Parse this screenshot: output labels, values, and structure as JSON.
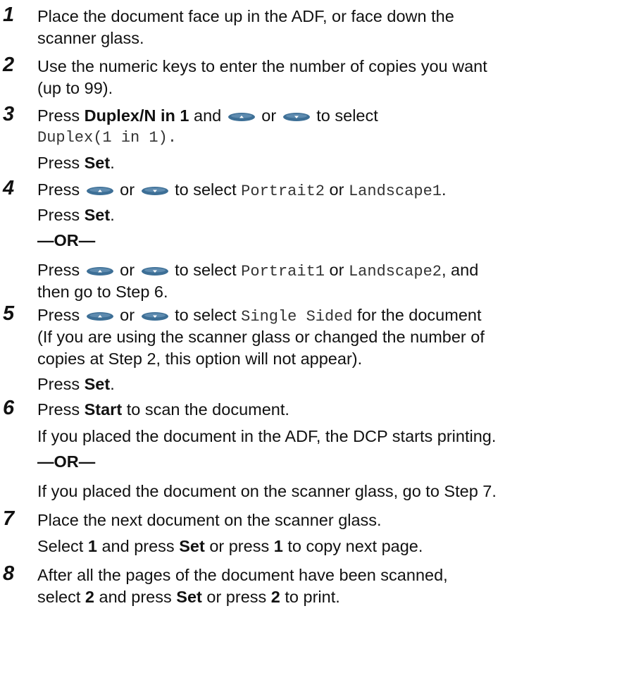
{
  "steps": [
    {
      "num": "1",
      "lines": [
        "Place the document face up in the ADF, or face down the",
        "scanner glass."
      ]
    },
    {
      "num": "2",
      "lines": [
        "Use the numeric keys to enter the number of copies you want",
        "(up to 99)."
      ]
    },
    {
      "num": "3",
      "press": "Press",
      "btn_duplex": "Duplex/N in 1",
      "and": "and",
      "or": "or",
      "to_select": "to select",
      "mode": "Duplex(1 in 1).",
      "press_set_a": "Press",
      "set": "Set",
      "period": "."
    },
    {
      "num": "4",
      "press": "Press",
      "or": "or",
      "to_select": "to select",
      "opt_a": "Portrait2",
      "or_word": "or",
      "opt_b": "Landscape1",
      "period": ".",
      "press_set": "Press",
      "set": "Set",
      "or_sep": "—OR—",
      "press2": "Press",
      "or2": "or",
      "to_select2": "to select",
      "opt_c": "Portrait1",
      "or_word2": "or",
      "opt_d": "Landscape2",
      "and_text": ", and",
      "then_text": "then go to Step 6."
    },
    {
      "num": "5",
      "press": "Press",
      "or": "or",
      "to_select": "to select",
      "opt": "Single Sided",
      "for_doc": "for the document",
      "line2": "(If you are using the scanner glass or changed the number of",
      "line3": "copies at Step 2, this option will not appear).",
      "press_set": "Press",
      "set": "Set",
      "period": "."
    },
    {
      "num": "6",
      "press": "Press",
      "start": "Start",
      "scan_text": "to scan the document.",
      "line2": "If you placed the document in the ADF, the DCP starts printing.",
      "or_sep": "—OR—",
      "line4": "If you placed the document on the scanner glass, go to Step 7."
    },
    {
      "num": "7",
      "line1": "Place the next document on the scanner glass.",
      "select": "Select",
      "one": "1",
      "and_press": "and press",
      "set": "Set",
      "or_press": "or press",
      "one_b": "1",
      "copy_text": "to copy next page."
    },
    {
      "num": "8",
      "line1": "After all the pages of the document have been scanned,",
      "select": "select",
      "two": "2",
      "and_press": "and press",
      "set": "Set",
      "or_press": "or press",
      "two_b": "2",
      "print_text": "to print."
    }
  ],
  "icons": {
    "up": "up-arrow-key-icon",
    "down": "down-arrow-key-icon",
    "key_color": "#3d6f96"
  }
}
